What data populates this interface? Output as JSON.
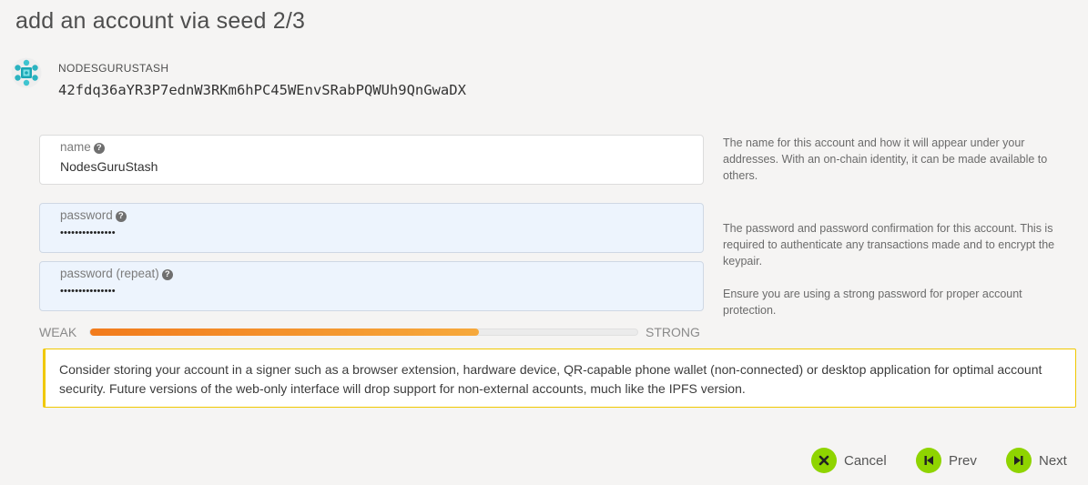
{
  "page": {
    "title": "add an account via seed 2/3"
  },
  "account": {
    "name": "NODESGURUSTASH",
    "address": "42fdq36aYR3P7ednW3RKm6hPC45WEnvSRabPQWUh9QnGwaDX",
    "icon": "identicon"
  },
  "form": {
    "name_label": "name",
    "name_value": "NodesGuruStash",
    "name_help": "The name for this account and how it will appear under your addresses. With an on-chain identity, it can be made available to others.",
    "password_label": "password",
    "password_value": "•••••••••••••••",
    "password_repeat_label": "password (repeat)",
    "password_repeat_value": "•••••••••••••••",
    "password_help_1": "The password and password confirmation for this account. This is required to authenticate any transactions made and to encrypt the keypair.",
    "password_help_2": "Ensure you are using a strong password for proper account protection."
  },
  "strength": {
    "weak_label": "WEAK",
    "strong_label": "STRONG",
    "level": 0.71,
    "color": "#f39a2b"
  },
  "warning": {
    "text": "Consider storing your account in a signer such as a browser extension, hardware device, QR-capable phone wallet (non-connected) or desktop application for optimal account security. Future versions of the web-only interface will drop support for non-external accounts, much like the IPFS version.",
    "border_color": "#f0c800"
  },
  "actions": {
    "cancel_label": "Cancel",
    "prev_label": "Prev",
    "next_label": "Next",
    "accent": "#8fd400"
  }
}
